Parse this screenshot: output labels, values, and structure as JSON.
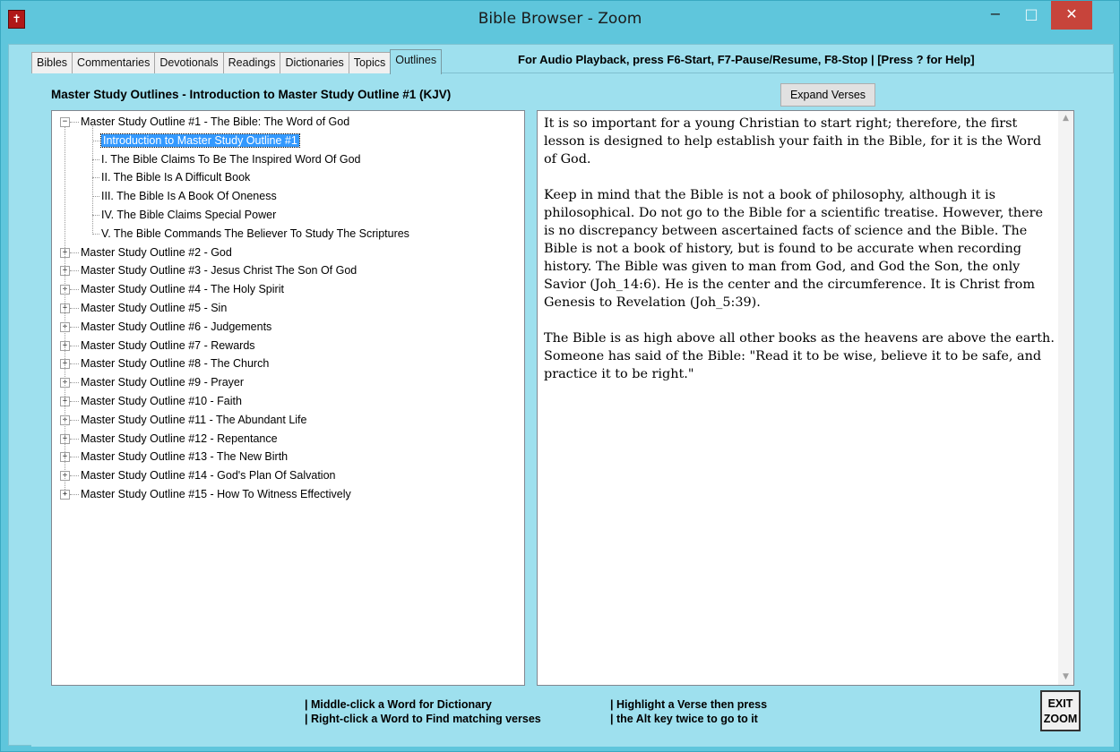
{
  "window": {
    "title": "Bible Browser - Zoom",
    "app_icon": "bible-icon",
    "minimize_glyph": "−",
    "maximize_glyph": "□",
    "close_glyph": "✕"
  },
  "tabs": [
    {
      "label": "Bibles",
      "active": false
    },
    {
      "label": "Commentaries",
      "active": false
    },
    {
      "label": "Devotionals",
      "active": false
    },
    {
      "label": "Readings",
      "active": false
    },
    {
      "label": "Dictionaries",
      "active": false
    },
    {
      "label": "Topics",
      "active": false
    },
    {
      "label": "Outlines",
      "active": true
    }
  ],
  "tab_info": "For Audio Playback, press F6-Start, F7-Pause/Resume, F8-Stop   |   [Press ? for Help]",
  "heading": "Master Study Outlines - Introduction to Master Study Outline #1   (KJV)",
  "expand_button": "Expand Verses",
  "tree": {
    "expanded": {
      "label": "Master Study Outline #1 - The Bible: The Word of God",
      "children": [
        "Introduction to Master Study Outline #1",
        "I. The Bible Claims To Be The Inspired Word Of God",
        "II. The Bible Is A Difficult Book",
        "III. The Bible Is A Book Of Oneness",
        "IV. The Bible Claims Special Power",
        "V. The Bible Commands The Believer To Study The Scriptures"
      ],
      "selected_child": 0
    },
    "collapsed": [
      "Master Study Outline #2 - God",
      "Master Study Outline #3 - Jesus Christ The Son Of God",
      "Master Study Outline #4 - The Holy Spirit",
      "Master Study Outline #5 - Sin",
      "Master Study Outline #6 - Judgements",
      "Master Study Outline #7 - Rewards",
      "Master Study Outline #8 - The Church",
      "Master Study Outline #9 - Prayer",
      "Master Study Outline #10 - Faith",
      "Master Study Outline #11 - The Abundant Life",
      "Master Study Outline #12 - Repentance",
      "Master Study Outline #13 - The New Birth",
      "Master Study Outline #14 - God's Plan Of Salvation",
      "Master Study Outline #15 - How To Witness Effectively"
    ]
  },
  "reader": {
    "paragraphs": [
      "It is so important for a young Christian to start right; therefore, the first lesson is designed to help establish your faith in the Bible, for it is the Word of God.",
      "Keep in mind that the Bible is not a book of philosophy, although it is philosophical. Do not go to the Bible for a scientific treatise. However, there is no discrepancy between ascertained facts of science and the Bible. The Bible is not a book of history, but is found to be accurate when recording history. The Bible was given to man from God, and God the Son, the only Savior (Joh_14:6). He is the center and the circumference. It is Christ from Genesis to Revelation (Joh_5:39).",
      "The Bible is as high above all other books as the heavens are above the earth. Someone has said of the Bible: \"Read it to be wise, believe it to be safe, and practice it to be right.\""
    ]
  },
  "footer": {
    "hint_left_1": "| Middle-click a Word for Dictionary",
    "hint_left_2": "| Right-click a Word to Find matching verses",
    "hint_right_1": "| Highlight a Verse then press",
    "hint_right_2": "| the Alt key twice to go to it",
    "exit_line1": "EXIT",
    "exit_line2": "ZOOM"
  }
}
